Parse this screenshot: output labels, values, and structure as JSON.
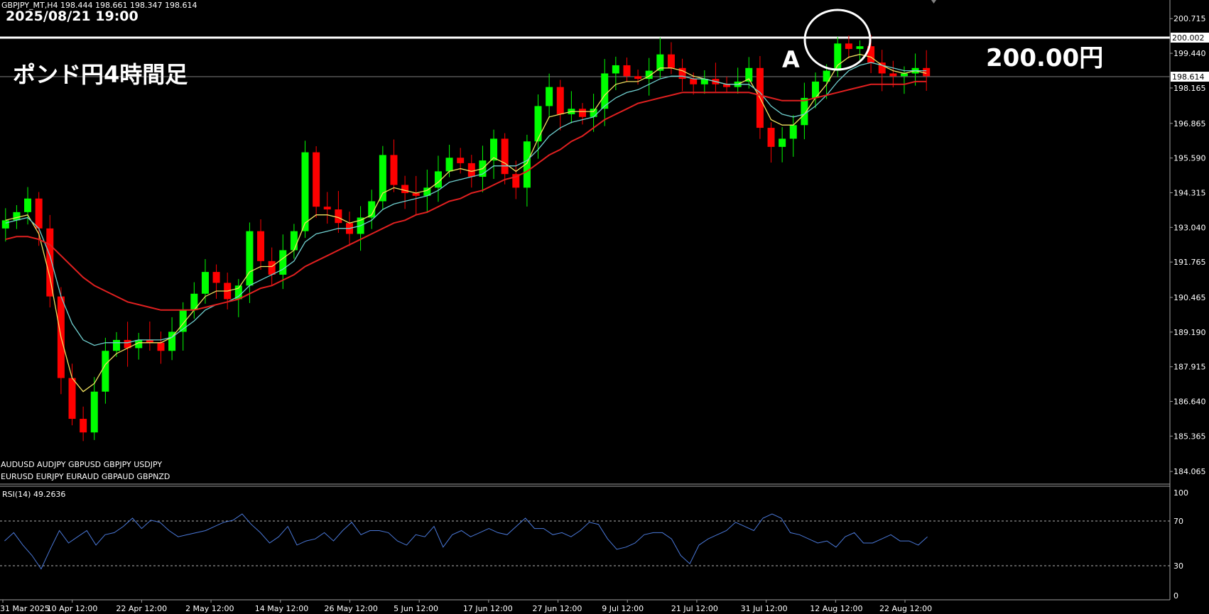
{
  "header": {
    "symbol_line": "GBPJPY_MT,H4  198.444 198.661 198.347 198.614",
    "datetime": "2025/08/21 19:00"
  },
  "title": "ポンド円4時間足",
  "annotations": {
    "point_label": "A",
    "level_label": "200.00円"
  },
  "price_tags": {
    "resistance": "200.002",
    "current": "198.614"
  },
  "symbols": {
    "row1": "AUDUSD  AUDJPY   GBPUSD  GBPJPY   USDJPY",
    "row2": "EURUSD  EURJPY   EURAUD  GBPAUD  GBPNZD"
  },
  "rsi": {
    "label": "RSI(14) 49.2636",
    "levels": [
      "100",
      "70",
      "30",
      "0"
    ],
    "values": [
      52,
      60,
      48,
      38,
      25,
      44,
      62,
      50,
      56,
      62,
      48,
      58,
      60,
      66,
      74,
      64,
      72,
      70,
      62,
      56,
      58,
      60,
      62,
      66,
      70,
      72,
      78,
      68,
      60,
      50,
      56,
      66,
      48,
      52,
      54,
      60,
      52,
      62,
      70,
      58,
      62,
      62,
      60,
      52,
      48,
      58,
      56,
      66,
      46,
      58,
      62,
      56,
      60,
      64,
      60,
      58,
      66,
      74,
      64,
      64,
      58,
      60,
      56,
      62,
      70,
      68,
      54,
      44,
      46,
      50,
      58,
      60,
      60,
      54,
      38,
      30,
      48,
      54,
      58,
      62,
      70,
      66,
      62,
      74,
      78,
      74,
      60,
      58,
      54,
      50,
      52,
      46,
      56,
      60,
      50,
      50,
      54,
      58,
      52,
      52,
      48,
      56
    ]
  },
  "chart_data": {
    "type": "candlestick",
    "symbol": "GBPJPY_MT,H4",
    "y_ticks": [
      "200.715",
      "199.440",
      "198.165",
      "196.865",
      "195.590",
      "194.315",
      "193.040",
      "191.765",
      "190.465",
      "189.190",
      "187.915",
      "186.640",
      "185.365",
      "184.065"
    ],
    "ylim": [
      183.6,
      201.4
    ],
    "x_ticks": [
      "31 Mar 2025",
      "10 Apr 12:00",
      "22 Apr 12:00",
      "2 May 12:00",
      "14 May 12:00",
      "26 May 12:00",
      "5 Jun 12:00",
      "17 Jun 12:00",
      "27 Jun 12:00",
      "9 Jul 12:00",
      "21 Jul 12:00",
      "31 Jul 12:00",
      "12 Aug 12:00",
      "22 Aug 12:00"
    ],
    "closes": [
      193.3,
      193.6,
      194.1,
      193.0,
      190.5,
      187.5,
      186.0,
      185.5,
      187.0,
      188.5,
      188.9,
      188.6,
      188.9,
      188.8,
      188.5,
      189.2,
      190.0,
      190.6,
      191.4,
      191.0,
      190.4,
      190.9,
      192.9,
      191.8,
      191.3,
      192.2,
      192.9,
      195.8,
      193.8,
      193.7,
      193.2,
      192.8,
      193.4,
      194.0,
      195.7,
      194.6,
      194.3,
      194.2,
      194.5,
      195.1,
      195.6,
      195.4,
      194.9,
      195.5,
      196.3,
      195.0,
      194.5,
      196.2,
      197.5,
      198.2,
      197.2,
      197.4,
      197.1,
      197.4,
      198.7,
      199.0,
      198.6,
      198.5,
      198.8,
      199.4,
      198.9,
      198.5,
      198.3,
      198.5,
      198.3,
      198.2,
      198.4,
      198.9,
      196.7,
      196.0,
      196.3,
      196.8,
      197.8,
      198.4,
      198.8,
      199.8,
      199.6,
      199.7,
      199.1,
      198.7,
      198.6,
      198.7,
      198.9,
      198.6
    ],
    "series": [
      {
        "name": "MA fast",
        "color": "#f0e060",
        "values": [
          193.3,
          193.4,
          193.5,
          192.8,
          191.2,
          189.0,
          187.5,
          187.0,
          187.3,
          188.0,
          188.4,
          188.6,
          188.8,
          188.8,
          188.8,
          189.0,
          189.5,
          190.0,
          190.5,
          190.7,
          190.7,
          190.8,
          191.4,
          191.6,
          191.6,
          191.9,
          192.2,
          193.2,
          193.5,
          193.5,
          193.4,
          193.2,
          193.3,
          193.5,
          194.3,
          194.5,
          194.4,
          194.3,
          194.4,
          194.7,
          195.1,
          195.2,
          195.1,
          195.2,
          195.6,
          195.4,
          195.1,
          195.4,
          196.3,
          197.1,
          197.2,
          197.3,
          197.3,
          197.3,
          197.9,
          198.3,
          198.4,
          198.4,
          198.6,
          198.9,
          198.9,
          198.8,
          198.6,
          198.5,
          198.4,
          198.3,
          198.3,
          198.5,
          197.8,
          197.0,
          196.8,
          196.8,
          197.2,
          197.8,
          198.3,
          199.0,
          199.3,
          199.4,
          199.3,
          199.0,
          198.8,
          198.7,
          198.8,
          198.7
        ]
      },
      {
        "name": "MA mid",
        "color": "#70d0d0",
        "values": [
          193.2,
          193.3,
          193.4,
          193.0,
          192.0,
          190.5,
          189.5,
          188.9,
          188.7,
          188.8,
          188.8,
          188.8,
          188.9,
          188.9,
          188.9,
          189.0,
          189.3,
          189.6,
          190.0,
          190.2,
          190.3,
          190.5,
          190.9,
          191.1,
          191.3,
          191.5,
          191.8,
          192.5,
          192.8,
          192.9,
          193.0,
          193.0,
          193.1,
          193.3,
          193.7,
          193.9,
          194.0,
          194.1,
          194.2,
          194.4,
          194.7,
          194.8,
          194.9,
          195.0,
          195.3,
          195.3,
          195.3,
          195.5,
          195.9,
          196.4,
          196.7,
          196.9,
          197.0,
          197.1,
          197.5,
          197.8,
          198.0,
          198.1,
          198.3,
          198.5,
          198.6,
          198.6,
          198.5,
          198.5,
          198.4,
          198.3,
          198.3,
          198.3,
          198.0,
          197.5,
          197.2,
          197.1,
          197.2,
          197.5,
          197.9,
          198.4,
          198.8,
          199.0,
          199.1,
          199.0,
          198.9,
          198.8,
          198.8,
          198.8
        ]
      },
      {
        "name": "MA slow",
        "color": "#e02020",
        "values": [
          192.6,
          192.7,
          192.7,
          192.6,
          192.4,
          192.0,
          191.6,
          191.2,
          190.9,
          190.7,
          190.5,
          190.3,
          190.2,
          190.1,
          190.0,
          190.0,
          190.0,
          190.0,
          190.1,
          190.2,
          190.3,
          190.4,
          190.6,
          190.8,
          190.9,
          191.1,
          191.3,
          191.6,
          191.8,
          192.0,
          192.2,
          192.4,
          192.6,
          192.8,
          193.0,
          193.2,
          193.3,
          193.5,
          193.6,
          193.8,
          194.0,
          194.1,
          194.3,
          194.4,
          194.6,
          194.8,
          194.9,
          195.1,
          195.4,
          195.7,
          195.9,
          196.2,
          196.4,
          196.7,
          197.0,
          197.2,
          197.4,
          197.6,
          197.7,
          197.8,
          197.9,
          198.0,
          198.0,
          198.0,
          198.0,
          198.0,
          198.0,
          198.0,
          197.9,
          197.8,
          197.7,
          197.7,
          197.7,
          197.8,
          197.9,
          198.0,
          198.1,
          198.2,
          198.3,
          198.3,
          198.3,
          198.3,
          198.4,
          198.4
        ]
      }
    ],
    "grid": false,
    "legend": "none"
  },
  "colors": {
    "up": "#00ff00",
    "down": "#ff0000",
    "rsi_line": "#4a78d8",
    "background": "#000000"
  }
}
